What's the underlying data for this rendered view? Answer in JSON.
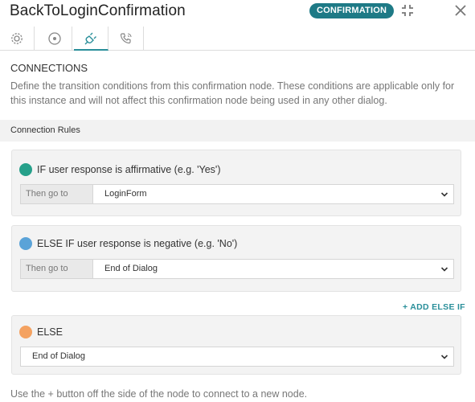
{
  "header": {
    "title": "BackToLoginConfirmation",
    "badge": "CONFIRMATION",
    "icons": [
      "collapse-icon",
      "close-icon"
    ]
  },
  "tabs": [
    {
      "icon": "gear-icon",
      "active": false
    },
    {
      "icon": "circle-target-icon",
      "active": false
    },
    {
      "icon": "plug-icon",
      "active": true
    },
    {
      "icon": "phone-icon",
      "active": false
    }
  ],
  "connections": {
    "title": "CONNECTIONS",
    "description": "Define the transition conditions from this confirmation node. These conditions are applicable only for this instance and will not affect this confirmation node being used in any other dialog."
  },
  "rules": {
    "label": "Connection Rules",
    "items": [
      {
        "condition": "IF user response is affirmative (e.g. 'Yes')",
        "goto_label": "Then go to",
        "value": "LoginForm",
        "color": "#26a08a"
      },
      {
        "condition": "ELSE IF user response is negative (e.g. 'No')",
        "goto_label": "Then go to",
        "value": "End of Dialog",
        "color": "#5aa3d8"
      },
      {
        "condition": "ELSE",
        "value": "End of Dialog",
        "color": "#f4a261"
      }
    ],
    "add_else_if": "+ ADD ELSE IF"
  },
  "footer": "Use the + button off the side of the node to connect to a new node.",
  "colors": {
    "accent": "#2a8f9a",
    "badge": "#1e7a86"
  }
}
